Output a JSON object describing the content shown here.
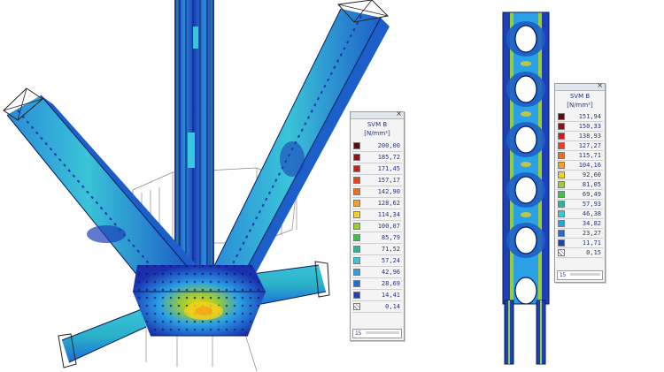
{
  "legend_left": {
    "title": "SVM B",
    "unit": "[N/mm²]",
    "values": [
      "200,00",
      "185,72",
      "171,45",
      "157,17",
      "142,90",
      "128,62",
      "114,34",
      "100,07",
      "85,79",
      "71,52",
      "57,24",
      "42,96",
      "28,69",
      "14,41",
      "0,14"
    ],
    "colors": [
      "#5a0d12",
      "#8e1418",
      "#c5221a",
      "#e9401c",
      "#f36b17",
      "#f7a11a",
      "#f2d119",
      "#9acd32",
      "#3ac34c",
      "#26b6a4",
      "#35c8df",
      "#2aa0e6",
      "#1d6fd8",
      "#1d3fb8",
      "#16127f"
    ],
    "footer": "15"
  },
  "legend_right": {
    "title": "SVM B",
    "unit": "[N/mm²]",
    "values": [
      "151,94",
      "150,33",
      "138,93",
      "127,27",
      "115,71",
      "104,16",
      "92,60",
      "81,05",
      "69,49",
      "57,93",
      "46,38",
      "34,82",
      "23,27",
      "11,71",
      "0,15"
    ],
    "colors": [
      "#5a0d12",
      "#8e1418",
      "#c5221a",
      "#e9401c",
      "#f36b17",
      "#f7a11a",
      "#f2d119",
      "#9acd32",
      "#3ac34c",
      "#26b6a4",
      "#35c8df",
      "#2aa0e6",
      "#1d6fd8",
      "#1d3fb8",
      "#16127f"
    ],
    "footer": "15"
  }
}
